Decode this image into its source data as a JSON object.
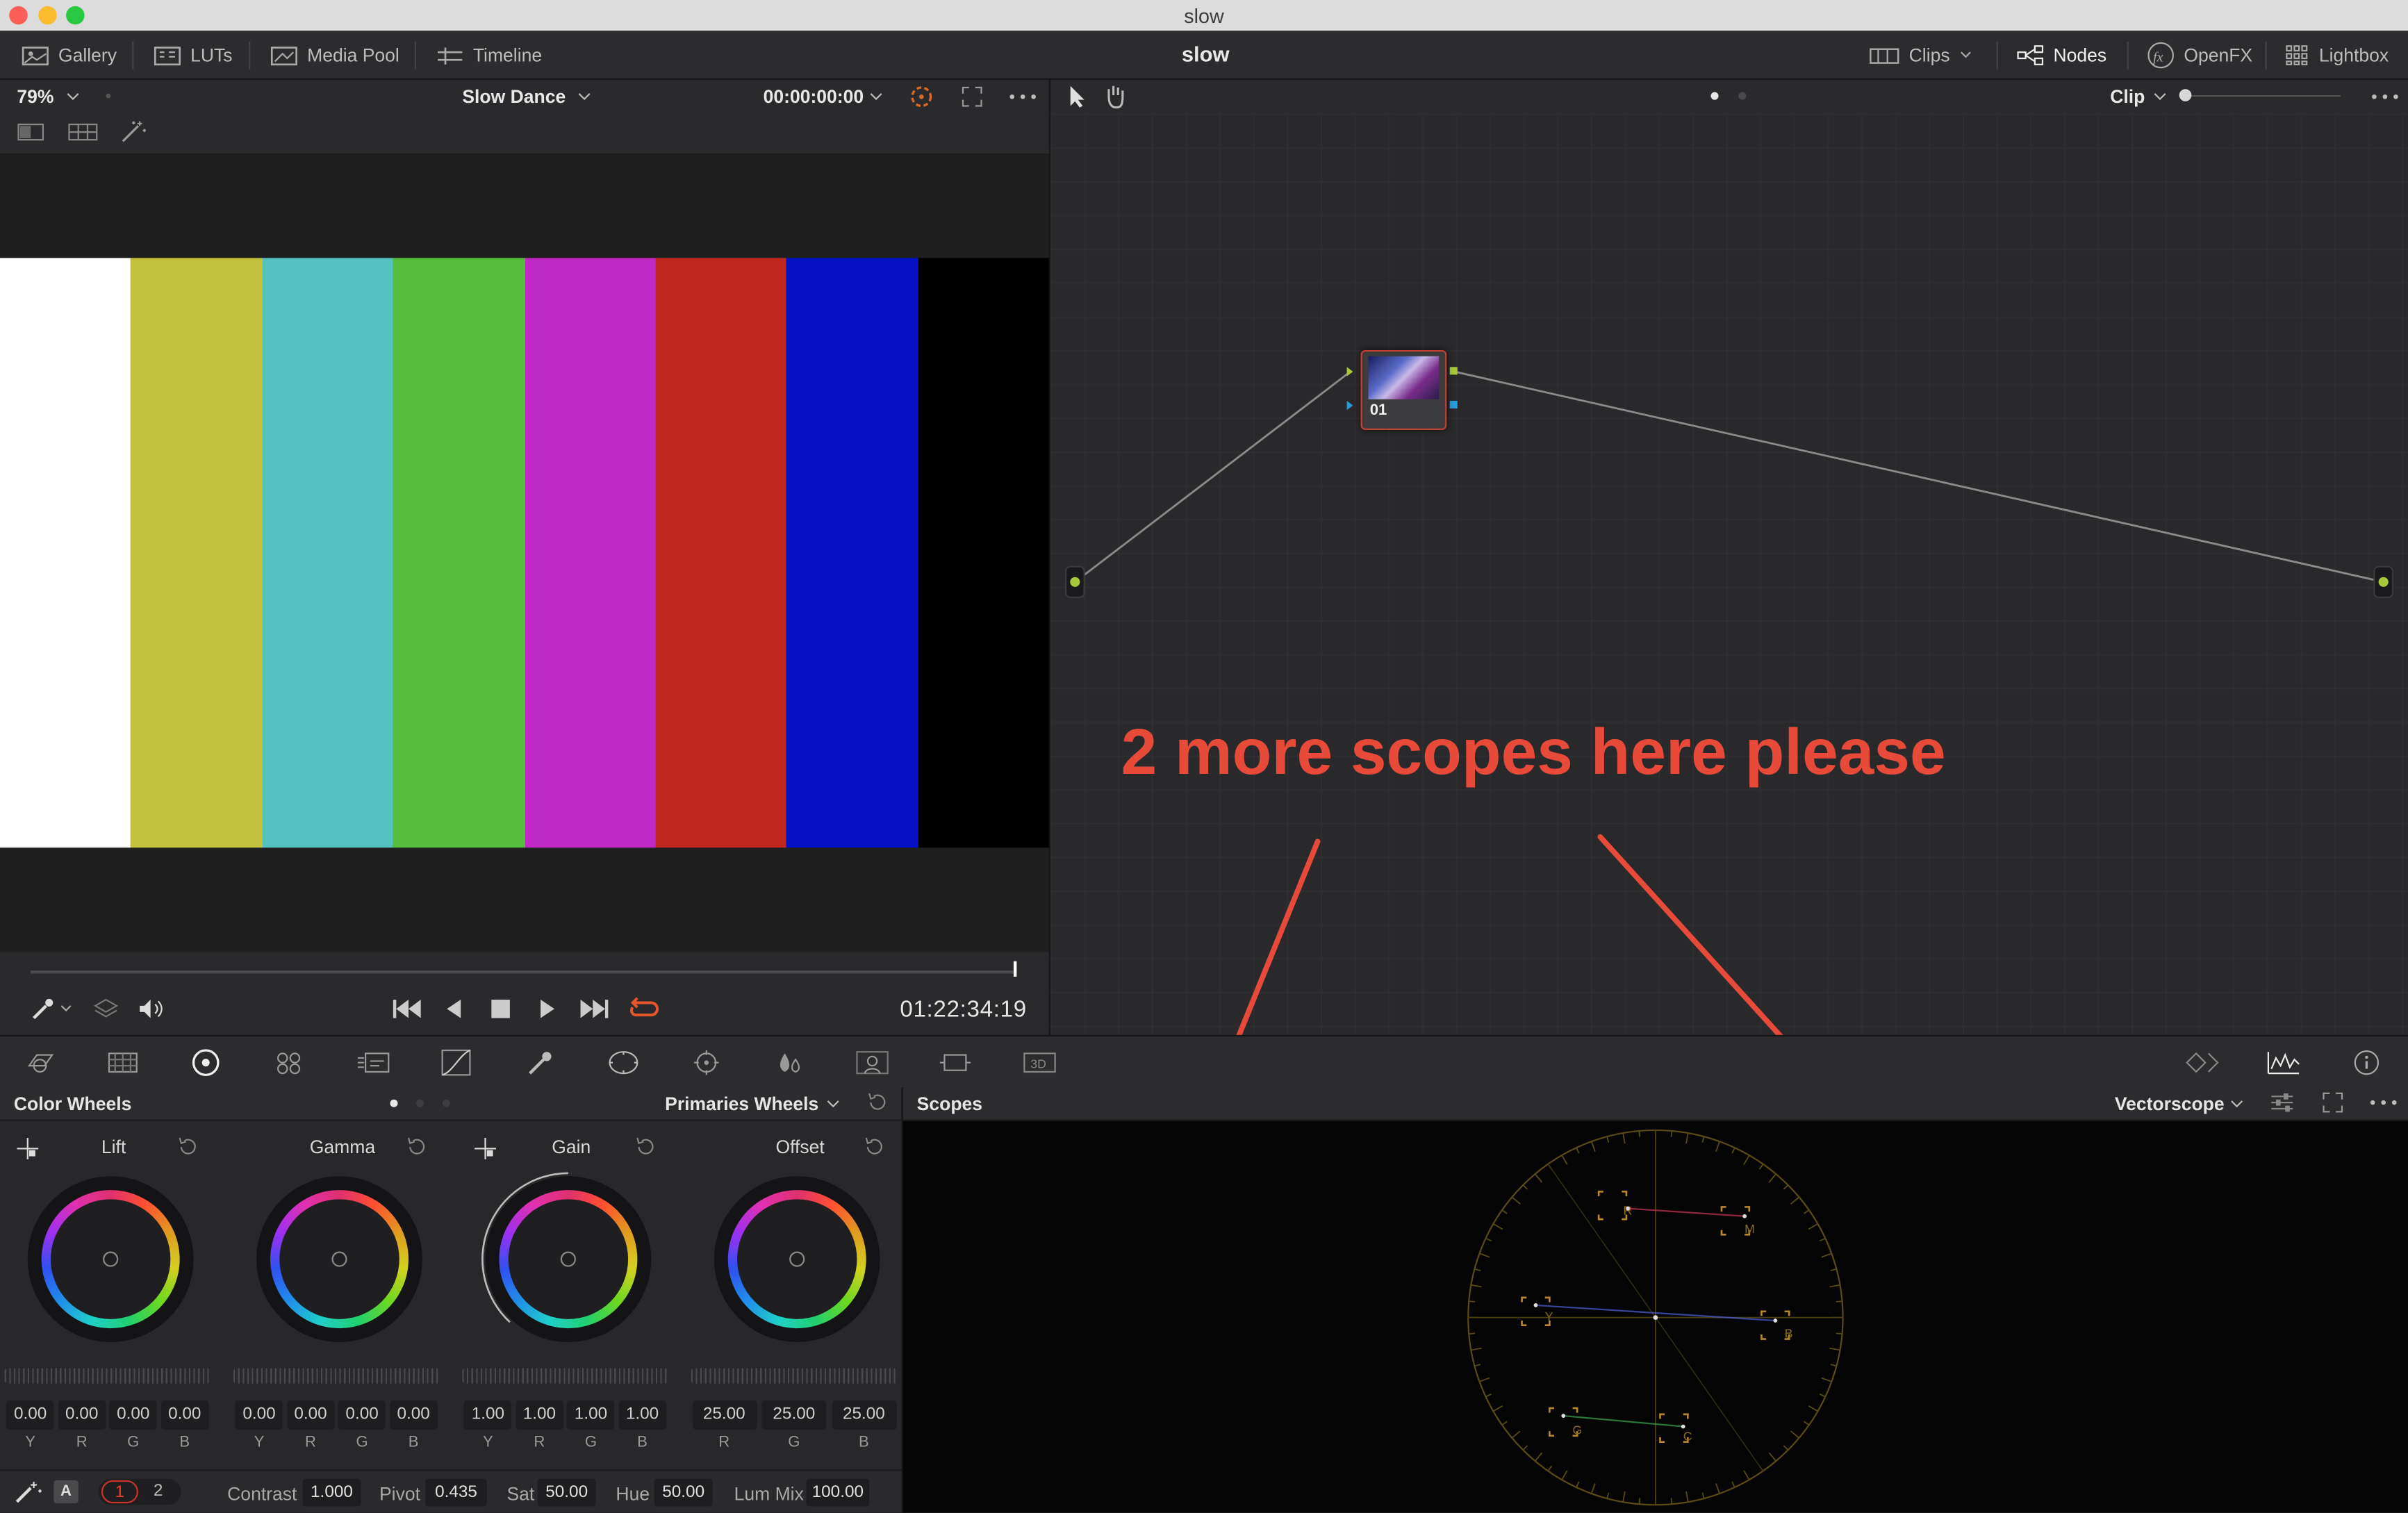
{
  "window": {
    "title": "slow"
  },
  "topnav": {
    "left": [
      {
        "label": "Gallery",
        "icon": "gallery-icon"
      },
      {
        "label": "LUTs",
        "icon": "luts-icon"
      },
      {
        "label": "Media Pool",
        "icon": "media-pool-icon"
      },
      {
        "label": "Timeline",
        "icon": "timeline-icon"
      }
    ],
    "project_title": "slow",
    "right": [
      {
        "label": "Clips",
        "icon": "clips-icon"
      },
      {
        "label": "Nodes",
        "icon": "nodes-icon",
        "active": true
      },
      {
        "label": "OpenFX",
        "icon": "openfx-icon"
      },
      {
        "label": "Lightbox",
        "icon": "lightbox-icon"
      }
    ]
  },
  "viewer": {
    "zoom": "79%",
    "clip_name": "Slow Dance",
    "timecode": "00:00:00:00",
    "playhead_timecode": "01:22:34:19",
    "scrub_position": 1.0,
    "test_pattern_colors": [
      "#ffffff",
      "#c3c240",
      "#55c2c0",
      "#56bf3e",
      "#c02ac4",
      "#c0271f",
      "#0711c4",
      "#000000"
    ]
  },
  "node_editor": {
    "mode": "Clip",
    "node": {
      "label": "01"
    }
  },
  "annotation": {
    "text": "2 more scopes here please",
    "color": "#e84a3a"
  },
  "color_wheels": {
    "title": "Color Wheels",
    "mode": "Primaries Wheels",
    "wheels": [
      {
        "name": "Lift",
        "values": [
          "0.00",
          "0.00",
          "0.00",
          "0.00"
        ],
        "channels": [
          "Y",
          "R",
          "G",
          "B"
        ]
      },
      {
        "name": "Gamma",
        "values": [
          "0.00",
          "0.00",
          "0.00",
          "0.00"
        ],
        "channels": [
          "Y",
          "R",
          "G",
          "B"
        ]
      },
      {
        "name": "Gain",
        "values": [
          "1.00",
          "1.00",
          "1.00",
          "1.00"
        ],
        "channels": [
          "Y",
          "R",
          "G",
          "B"
        ]
      },
      {
        "name": "Offset",
        "values": [
          "25.00",
          "25.00",
          "25.00"
        ],
        "channels": [
          "R",
          "G",
          "B"
        ]
      }
    ],
    "footer": {
      "auto_label": "A",
      "pages": [
        "1",
        "2"
      ],
      "contrast_label": "Contrast",
      "contrast": "1.000",
      "pivot_label": "Pivot",
      "pivot": "0.435",
      "sat_label": "Sat",
      "sat": "50.00",
      "hue_label": "Hue",
      "hue": "50.00",
      "lummix_label": "Lum Mix",
      "lummix": "100.00"
    }
  },
  "scopes": {
    "title": "Scopes",
    "mode": "Vectorscope",
    "targets": [
      "R",
      "M",
      "Y",
      "B",
      "G",
      "C"
    ]
  }
}
